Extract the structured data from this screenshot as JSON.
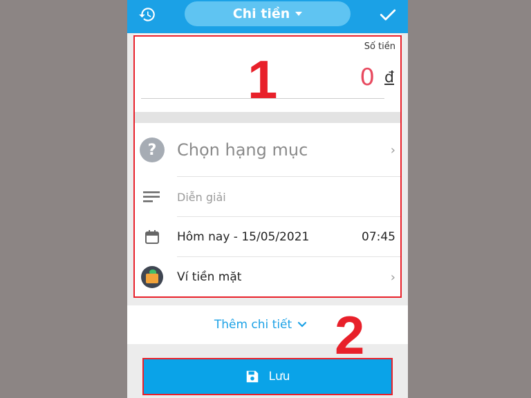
{
  "header": {
    "title": "Chi tiền",
    "history_icon": "history-icon",
    "confirm_icon": "check-icon"
  },
  "amount": {
    "label": "Số tiền",
    "value": "0",
    "currency": "đ"
  },
  "details": {
    "category_placeholder": "Chọn hạng mục",
    "note_placeholder": "Diễn giải",
    "date": "Hôm nay - 15/05/2021",
    "time": "07:45",
    "wallet": "Ví tiền mặt"
  },
  "more_details": "Thêm chi tiết",
  "save_label": "Lưu",
  "annotations": {
    "one": "1",
    "two": "2"
  },
  "colors": {
    "header_blue": "#1ba1e6",
    "amount_red": "#e84a5f",
    "annotation_red": "#e8202a",
    "save_blue": "#0aa3e8"
  }
}
